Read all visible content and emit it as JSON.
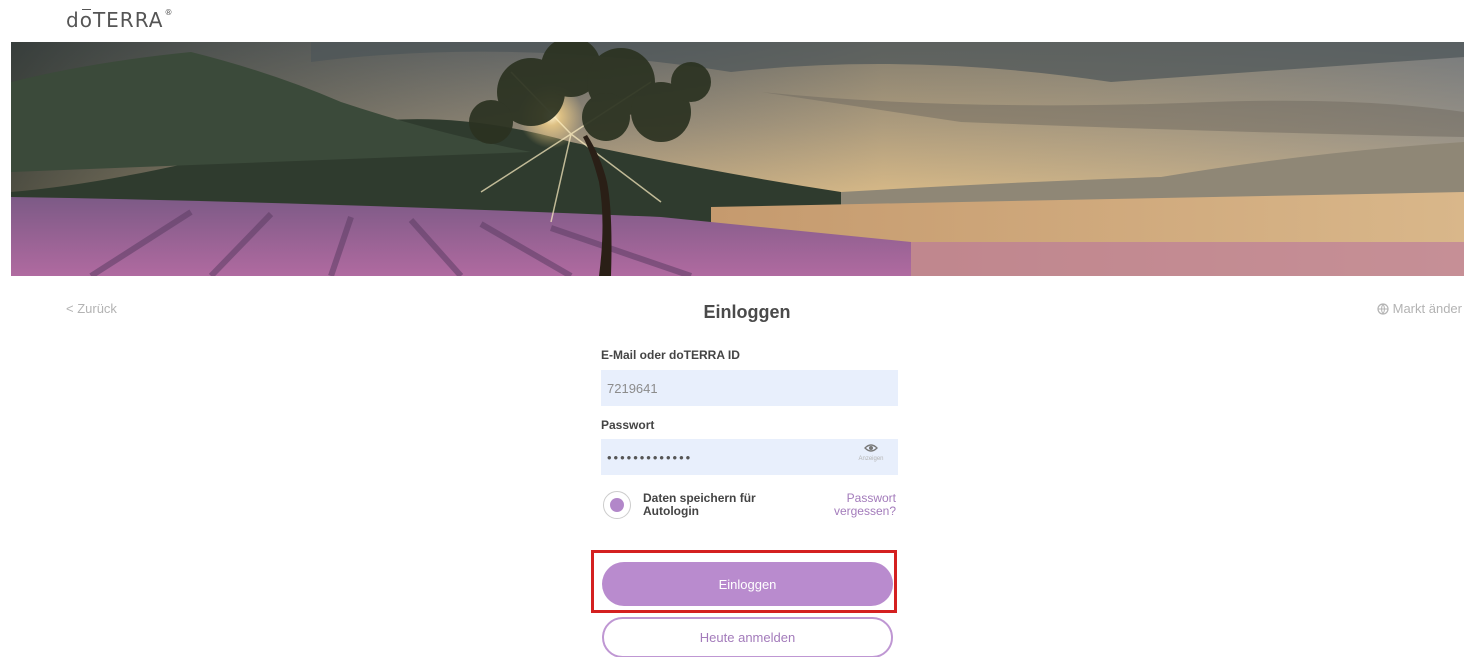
{
  "brand": {
    "logo_main": "d",
    "logo_o": "o",
    "logo_rest": "TERRA",
    "logo_reg": "®"
  },
  "nav": {
    "back_label": "< Zurück",
    "market_label": "Markt änder"
  },
  "form": {
    "title": "Einloggen",
    "email_label": "E-Mail oder doTERRA ID",
    "email_value": "7219641",
    "password_label": "Passwort",
    "password_value": "•••••••••••••",
    "show_password_label": "Anzeigen",
    "remember_label": "Daten speichern für Autologin",
    "forgot_label": "Passwort vergessen?",
    "login_button": "Einloggen",
    "register_button": "Heute anmelden"
  },
  "colors": {
    "accent": "#b98bce",
    "accent_text": "#a37bbb",
    "input_bg": "#e8effc",
    "highlight": "#d42020"
  },
  "icons": {
    "eye": "eye-icon",
    "globe": "globe-icon",
    "hero": "lavender-field-image"
  }
}
